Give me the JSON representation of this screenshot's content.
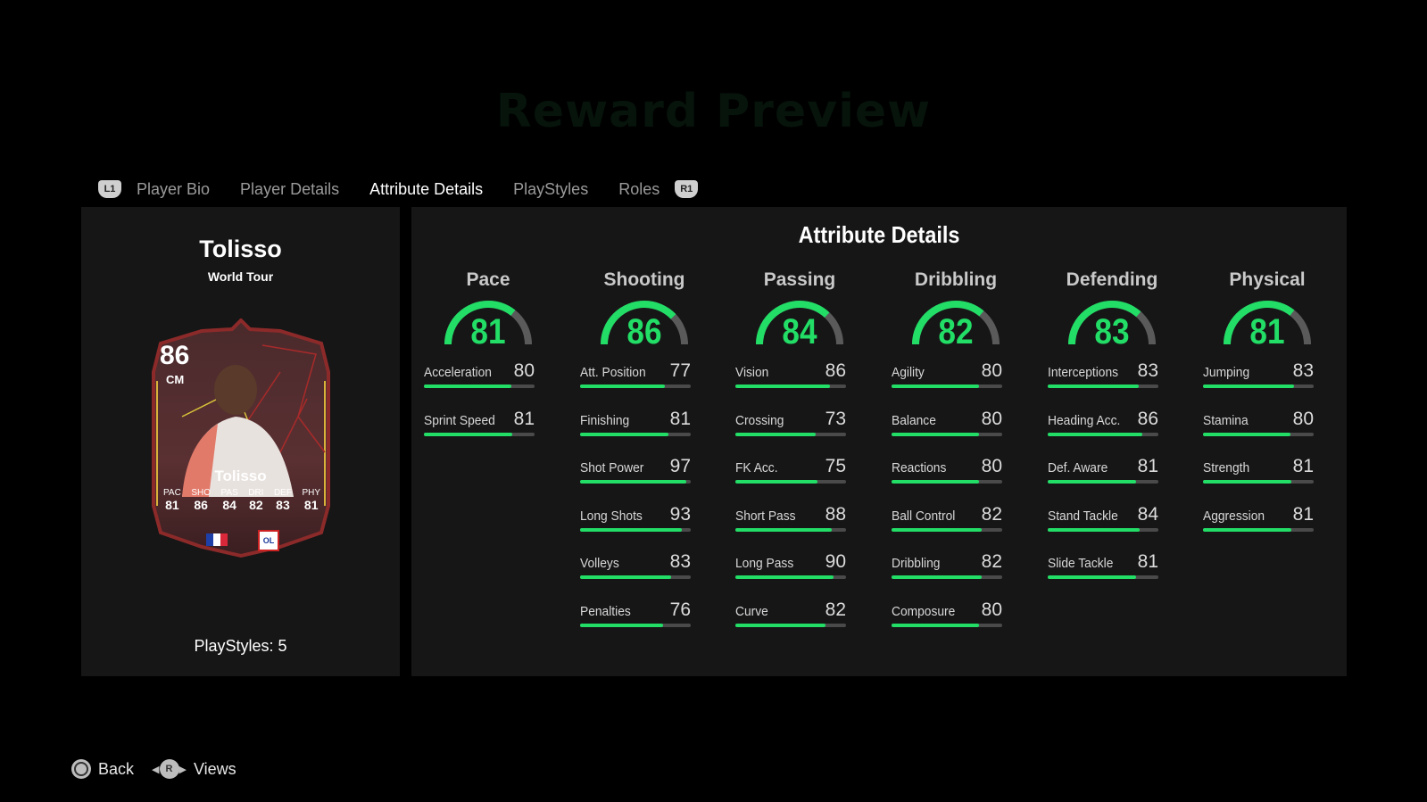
{
  "background_title": "Reward Preview",
  "tabs": {
    "left_bumper": "L1",
    "right_bumper": "R1",
    "items": [
      {
        "label": "Player Bio",
        "active": false
      },
      {
        "label": "Player Details",
        "active": false
      },
      {
        "label": "Attribute Details",
        "active": true
      },
      {
        "label": "PlayStyles",
        "active": false
      },
      {
        "label": "Roles",
        "active": false
      }
    ]
  },
  "player": {
    "name": "Tolisso",
    "card_type": "World Tour",
    "rating": "86",
    "position": "CM",
    "card_name": "Tolisso",
    "card_stats": [
      {
        "label": "PAC",
        "value": "81"
      },
      {
        "label": "SHO",
        "value": "86"
      },
      {
        "label": "PAS",
        "value": "84"
      },
      {
        "label": "DRI",
        "value": "82"
      },
      {
        "label": "DEF",
        "value": "83"
      },
      {
        "label": "PHY",
        "value": "81"
      }
    ],
    "nation": "France",
    "club": "OL",
    "playstyles_label": "PlayStyles: 5"
  },
  "attributes": {
    "title": "Attribute Details",
    "accent_color": "#22dd66",
    "categories": [
      {
        "name": "Pace",
        "value": 81,
        "stats": [
          {
            "label": "Acceleration",
            "value": 80
          },
          {
            "label": "Sprint Speed",
            "value": 81
          }
        ]
      },
      {
        "name": "Shooting",
        "value": 86,
        "stats": [
          {
            "label": "Att. Position",
            "value": 77
          },
          {
            "label": "Finishing",
            "value": 81
          },
          {
            "label": "Shot Power",
            "value": 97
          },
          {
            "label": "Long Shots",
            "value": 93
          },
          {
            "label": "Volleys",
            "value": 83
          },
          {
            "label": "Penalties",
            "value": 76
          }
        ]
      },
      {
        "name": "Passing",
        "value": 84,
        "stats": [
          {
            "label": "Vision",
            "value": 86
          },
          {
            "label": "Crossing",
            "value": 73
          },
          {
            "label": "FK Acc.",
            "value": 75
          },
          {
            "label": "Short Pass",
            "value": 88
          },
          {
            "label": "Long Pass",
            "value": 90
          },
          {
            "label": "Curve",
            "value": 82
          }
        ]
      },
      {
        "name": "Dribbling",
        "value": 82,
        "stats": [
          {
            "label": "Agility",
            "value": 80
          },
          {
            "label": "Balance",
            "value": 80
          },
          {
            "label": "Reactions",
            "value": 80
          },
          {
            "label": "Ball Control",
            "value": 82
          },
          {
            "label": "Dribbling",
            "value": 82
          },
          {
            "label": "Composure",
            "value": 80
          }
        ]
      },
      {
        "name": "Defending",
        "value": 83,
        "stats": [
          {
            "label": "Interceptions",
            "value": 83
          },
          {
            "label": "Heading Acc.",
            "value": 86
          },
          {
            "label": "Def. Aware",
            "value": 81
          },
          {
            "label": "Stand Tackle",
            "value": 84
          },
          {
            "label": "Slide Tackle",
            "value": 81
          }
        ]
      },
      {
        "name": "Physical",
        "value": 81,
        "stats": [
          {
            "label": "Jumping",
            "value": 83
          },
          {
            "label": "Stamina",
            "value": 80
          },
          {
            "label": "Strength",
            "value": 81
          },
          {
            "label": "Aggression",
            "value": 81
          }
        ]
      }
    ]
  },
  "footer": {
    "back_label": "Back",
    "views_label": "Views",
    "r_button": "R"
  }
}
